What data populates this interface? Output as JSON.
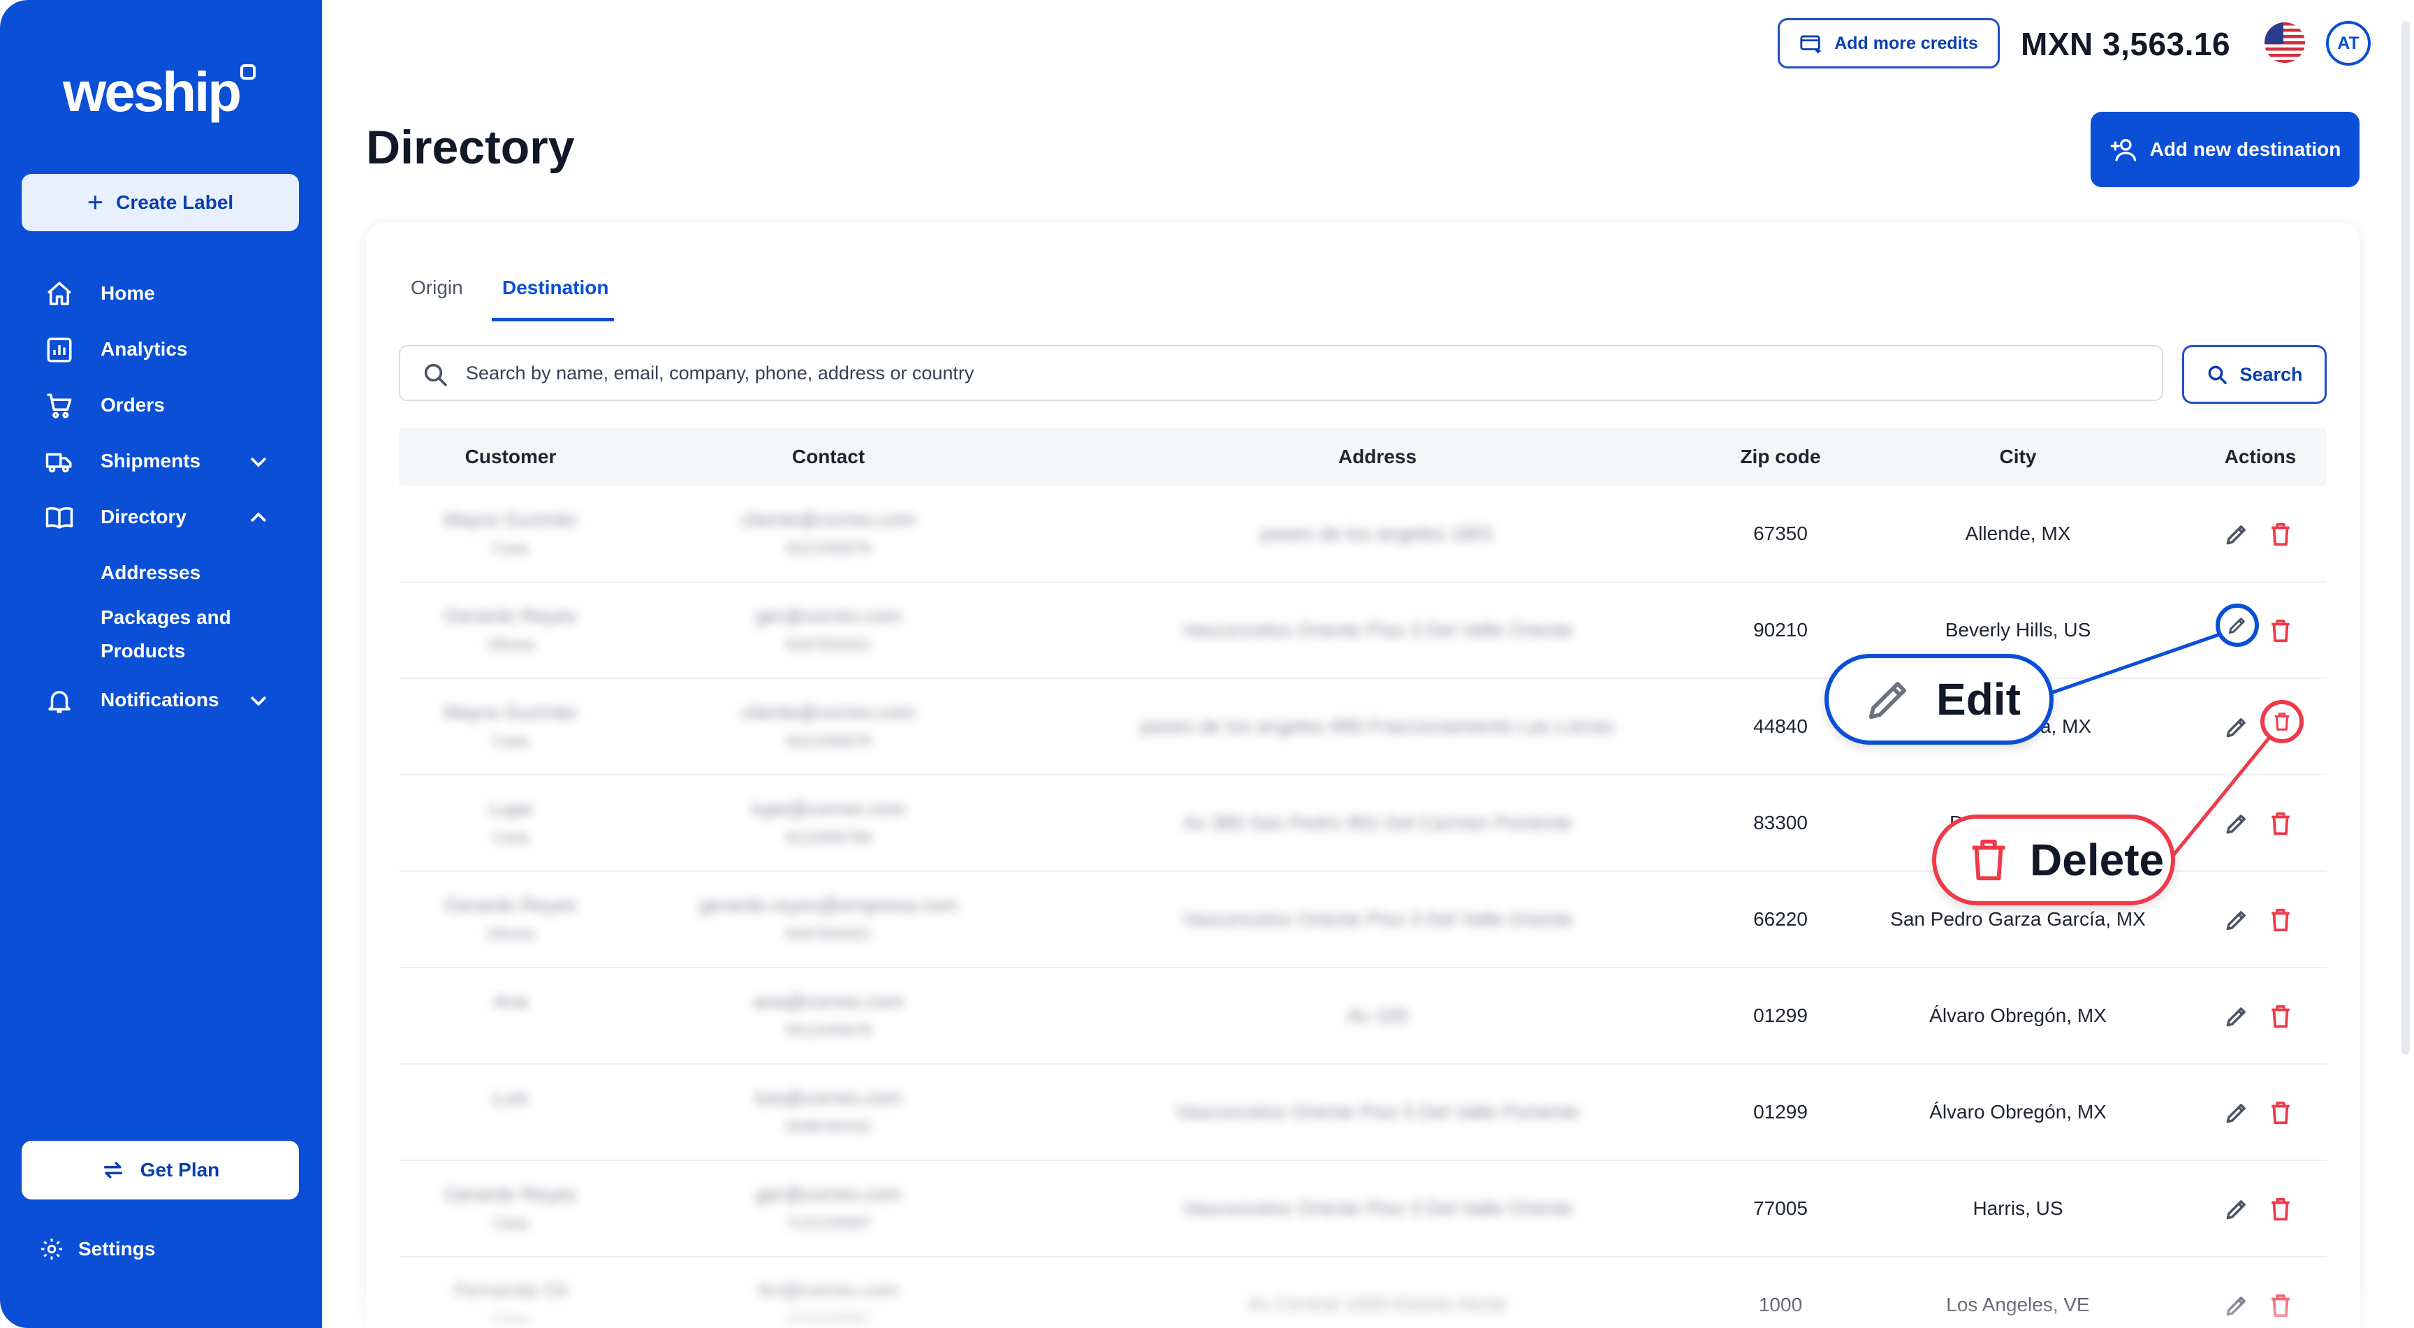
{
  "app": {
    "brand": "weship",
    "colors": {
      "primary": "#0a4fd6",
      "danger": "#ef3a4a",
      "sidebar": "#0a4fd6"
    }
  },
  "sidebar": {
    "create_label": "Create Label",
    "items": [
      {
        "label": "Home",
        "icon": "home-icon"
      },
      {
        "label": "Analytics",
        "icon": "analytics-icon"
      },
      {
        "label": "Orders",
        "icon": "cart-icon"
      },
      {
        "label": "Shipments",
        "icon": "truck-icon",
        "chevron": "down"
      },
      {
        "label": "Directory",
        "icon": "book-icon",
        "chevron": "up"
      }
    ],
    "directory_sub": [
      "Addresses",
      "Packages and",
      "Products"
    ],
    "notifications": "Notifications",
    "get_plan": "Get Plan",
    "settings": "Settings"
  },
  "topbar": {
    "add_credits": "Add more credits",
    "balance": "MXN 3,563.16",
    "avatar_initials": "AT",
    "flag": "us-flag-icon"
  },
  "header": {
    "title": "Directory",
    "add_destination": "Add new destination"
  },
  "tabs": [
    {
      "label": "Origin",
      "active": false
    },
    {
      "label": "Destination",
      "active": true
    }
  ],
  "search": {
    "placeholder": "Search by name, email, company, phone, address or country",
    "button": "Search"
  },
  "table": {
    "columns": [
      "Customer",
      "Contact",
      "Address",
      "Zip code",
      "City",
      "Actions"
    ],
    "rows": [
      {
        "customer": "Mayra Guzmán",
        "customer2": "Casa",
        "contact": "cliente@correo.com",
        "contact2": "8112345678",
        "address": "paseo de los angeles 1801",
        "zip": "67350",
        "city": "Allende, MX"
      },
      {
        "customer": "Gerardo Reyes",
        "customer2": "Oficina",
        "contact": "ger@correo.com",
        "contact2": "8187654321",
        "address": "Vasconcelos Oriente Piso 3 Del Valle Oriente",
        "zip": "90210",
        "city": "Beverly Hills, US"
      },
      {
        "customer": "Mayra Guzmán",
        "customer2": "Casa",
        "contact": "cliente@correo.com",
        "contact2": "8112345678",
        "address": "paseo de los angeles 890 Fraccionamiento Las Lomas",
        "zip": "44840",
        "city": "Guadalajara, MX"
      },
      {
        "customer": "Lupe",
        "customer2": "Casa",
        "contact": "lupe@correo.com",
        "contact2": "8123456789",
        "address": "Av 380 San Pedro 901 Del Carmen Poniente",
        "zip": "83300",
        "city": "Dzununcan, ED"
      },
      {
        "customer": "Gerardo Reyes",
        "customer2": "Oficina",
        "contact": "gerardo.reyes@empresa.com",
        "contact2": "8187654321",
        "address": "Vasconcelos Oriente Piso 3 Del Valle Oriente",
        "zip": "66220",
        "city": "San Pedro Garza García, MX"
      },
      {
        "customer": "Ana",
        "customer2": "",
        "contact": "ana@correo.com",
        "contact2": "5512345678",
        "address": "Av 100",
        "zip": "01299",
        "city": "Álvaro Obregón, MX"
      },
      {
        "customer": "Luis",
        "customer2": "",
        "contact": "luis@correo.com",
        "contact2": "5598765432",
        "address": "Vasconcelos Oriente Piso 5 Del Valle Poniente",
        "zip": "01299",
        "city": "Álvaro Obregón, MX"
      },
      {
        "customer": "Gerardo Reyes",
        "customer2": "Casa",
        "contact": "ger@correo.com",
        "contact2": "7131234567",
        "address": "Vasconcelos Oriente Piso 3 Del Valle Oriente",
        "zip": "77005",
        "city": "Harris, US"
      },
      {
        "customer": "Fernanda Gil",
        "customer2": "Casa",
        "contact": "fer@correo.com",
        "contact2": "2131234567",
        "address": "Av Central 1000 Distrito Norte",
        "zip": "1000",
        "city": "Los Angeles, VE"
      }
    ]
  },
  "callouts": {
    "edit": "Edit",
    "delete": "Delete"
  }
}
